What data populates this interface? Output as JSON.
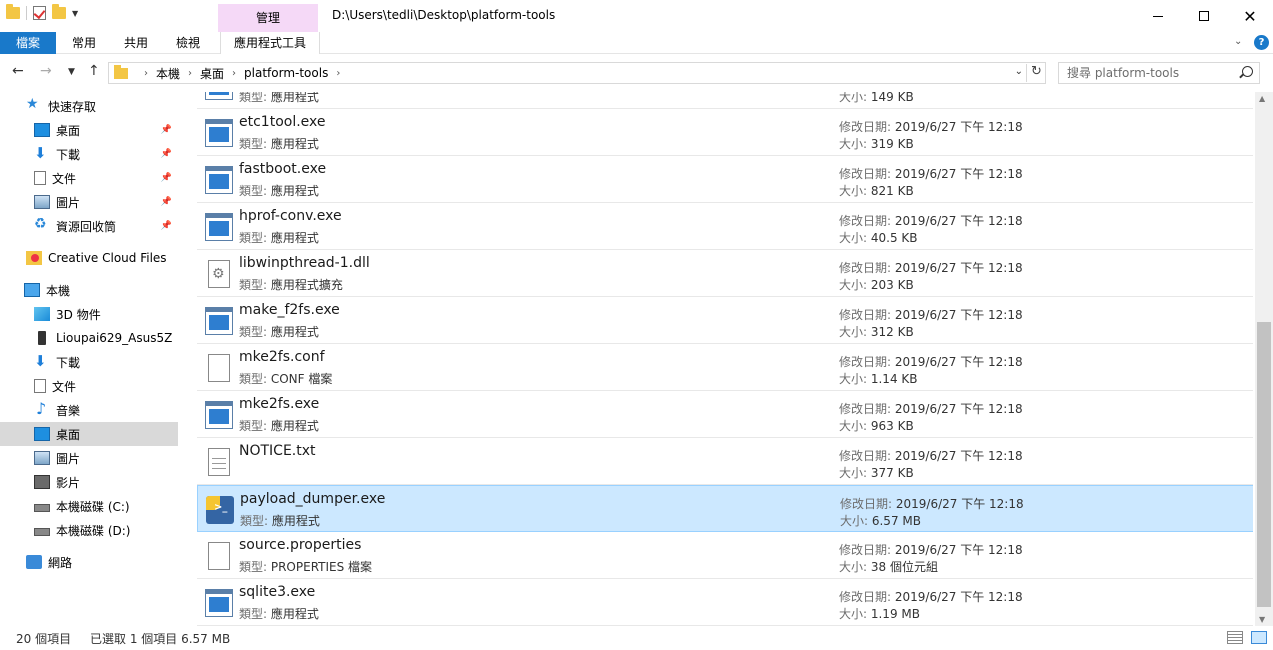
{
  "window": {
    "title_path": "D:\\Users\\tedli\\Desktop\\platform-tools",
    "context_tab": "管理",
    "minimize": "—",
    "close": "✕"
  },
  "ribbon": {
    "tabs": [
      "檔案",
      "常用",
      "共用",
      "檢視",
      "應用程式工具"
    ],
    "help": "?"
  },
  "address": {
    "crumbs": [
      "本機",
      "桌面",
      "platform-tools"
    ],
    "search_placeholder": "搜尋 platform-tools"
  },
  "sidebar": {
    "items": [
      {
        "label": "快速存取",
        "icon": "star-icon",
        "pinned": false
      },
      {
        "label": "桌面",
        "icon": "desktop-icon",
        "pinned": true
      },
      {
        "label": "下載",
        "icon": "download-icon",
        "pinned": true
      },
      {
        "label": "文件",
        "icon": "document-icon",
        "pinned": true
      },
      {
        "label": "圖片",
        "icon": "pictures-icon",
        "pinned": true
      },
      {
        "label": "資源回收筒",
        "icon": "recycle-bin-icon",
        "pinned": true
      },
      {
        "label": "Creative Cloud Files",
        "icon": "creative-cloud-icon",
        "pinned": false
      },
      {
        "label": "本機",
        "icon": "this-pc-icon",
        "pinned": false
      },
      {
        "label": "3D 物件",
        "icon": "3d-objects-icon",
        "pinned": false
      },
      {
        "label": "Lioupai629_Asus5Z",
        "icon": "phone-icon",
        "pinned": false
      },
      {
        "label": "下載",
        "icon": "download-icon",
        "pinned": false
      },
      {
        "label": "文件",
        "icon": "document-icon",
        "pinned": false
      },
      {
        "label": "音樂",
        "icon": "music-icon",
        "pinned": false
      },
      {
        "label": "桌面",
        "icon": "desktop-icon",
        "pinned": false
      },
      {
        "label": "圖片",
        "icon": "pictures-icon",
        "pinned": false
      },
      {
        "label": "影片",
        "icon": "video-icon",
        "pinned": false
      },
      {
        "label": "本機磁碟 (C:)",
        "icon": "drive-icon",
        "pinned": false
      },
      {
        "label": "本機磁碟 (D:)",
        "icon": "drive-icon",
        "pinned": false
      },
      {
        "label": "網路",
        "icon": "network-icon",
        "pinned": false
      }
    ],
    "selected_label": "桌面"
  },
  "labels": {
    "type": "類型: ",
    "modified": "修改日期: ",
    "size": "大小: "
  },
  "files": [
    {
      "name": "",
      "type": "應用程式",
      "date": "",
      "size": "149 KB",
      "icon": "exe-icon"
    },
    {
      "name": "etc1tool.exe",
      "type": "應用程式",
      "date": "2019/6/27 下午 12:18",
      "size": "319 KB",
      "icon": "exe-icon"
    },
    {
      "name": "fastboot.exe",
      "type": "應用程式",
      "date": "2019/6/27 下午 12:18",
      "size": "821 KB",
      "icon": "exe-icon"
    },
    {
      "name": "hprof-conv.exe",
      "type": "應用程式",
      "date": "2019/6/27 下午 12:18",
      "size": "40.5 KB",
      "icon": "exe-icon"
    },
    {
      "name": "libwinpthread-1.dll",
      "type": "應用程式擴充",
      "date": "2019/6/27 下午 12:18",
      "size": "203 KB",
      "icon": "dll-icon"
    },
    {
      "name": "make_f2fs.exe",
      "type": "應用程式",
      "date": "2019/6/27 下午 12:18",
      "size": "312 KB",
      "icon": "exe-icon"
    },
    {
      "name": "mke2fs.conf",
      "type": "CONF 檔案",
      "date": "2019/6/27 下午 12:18",
      "size": "1.14 KB",
      "icon": "file-icon"
    },
    {
      "name": "mke2fs.exe",
      "type": "應用程式",
      "date": "2019/6/27 下午 12:18",
      "size": "963 KB",
      "icon": "exe-icon"
    },
    {
      "name": "NOTICE.txt",
      "type": "",
      "date": "2019/6/27 下午 12:18",
      "size": "377 KB",
      "icon": "text-file-icon"
    },
    {
      "name": "payload_dumper.exe",
      "type": "應用程式",
      "date": "2019/6/27 下午 12:18",
      "size": "6.57 MB",
      "icon": "python-exe-icon",
      "selected": true
    },
    {
      "name": "source.properties",
      "type": "PROPERTIES 檔案",
      "date": "2019/6/27 下午 12:18",
      "size": "38 個位元組",
      "icon": "file-icon"
    },
    {
      "name": "sqlite3.exe",
      "type": "應用程式",
      "date": "2019/6/27 下午 12:18",
      "size": "1.19 MB",
      "icon": "exe-icon"
    }
  ],
  "status": {
    "count": "20 個項目",
    "selection": "已選取 1 個項目  6.57 MB"
  }
}
